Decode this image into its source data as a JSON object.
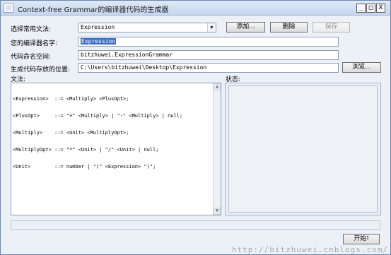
{
  "window": {
    "title": "Context-free Grammar的编译器代码的生成器",
    "min_glyph": "_",
    "max_glyph": "□",
    "close_glyph": "X"
  },
  "form": {
    "grammar_select_label": "选择常用文法:",
    "grammar_select_value": "Expression",
    "add_button": "添加...",
    "delete_button": "删除",
    "save_button": "保存",
    "compiler_name_label": "您的编译器名字:",
    "compiler_name_value": "Expression",
    "namespace_label": "代码命名空间:",
    "namespace_value": "bitzhuwei.ExpressionGrammar",
    "output_path_label": "生成代码存放的位置:",
    "output_path_value": "C:\\Users\\bitzhuwei\\Desktop\\Expression",
    "browse_button": "浏览...",
    "grammar_label": "文法:",
    "status_label": "状态:",
    "start_button": "开始!"
  },
  "grammar_lines": [
    "<Expression>  ::= <Multiply> <PlusOpt>;",
    "<PlusOpt>     ::= \"+\" <Multiply> | \"-\" <Multiply> | null;",
    "<Multiply>    ::= <Unit> <MultiplyOpt>;",
    "<MultiplyOpt> ::= \"*\" <Unit> | \"/\" <Unit> | null;",
    "<Unit>        ::= number | \"(\" <Expression> \")\";"
  ],
  "icons": {
    "app": "app-window-icon",
    "dropdown": "chevron-down-icon",
    "scroll_up": "scroll-up-arrow-icon",
    "scroll_down": "scroll-down-arrow-icon"
  },
  "watermark": "http://bitzhuwei.cnblogs.com/",
  "colors": {
    "window_bg": "#ecf1f7",
    "selection": "#3a6ec6",
    "titlebar": "#c5d6ee"
  }
}
